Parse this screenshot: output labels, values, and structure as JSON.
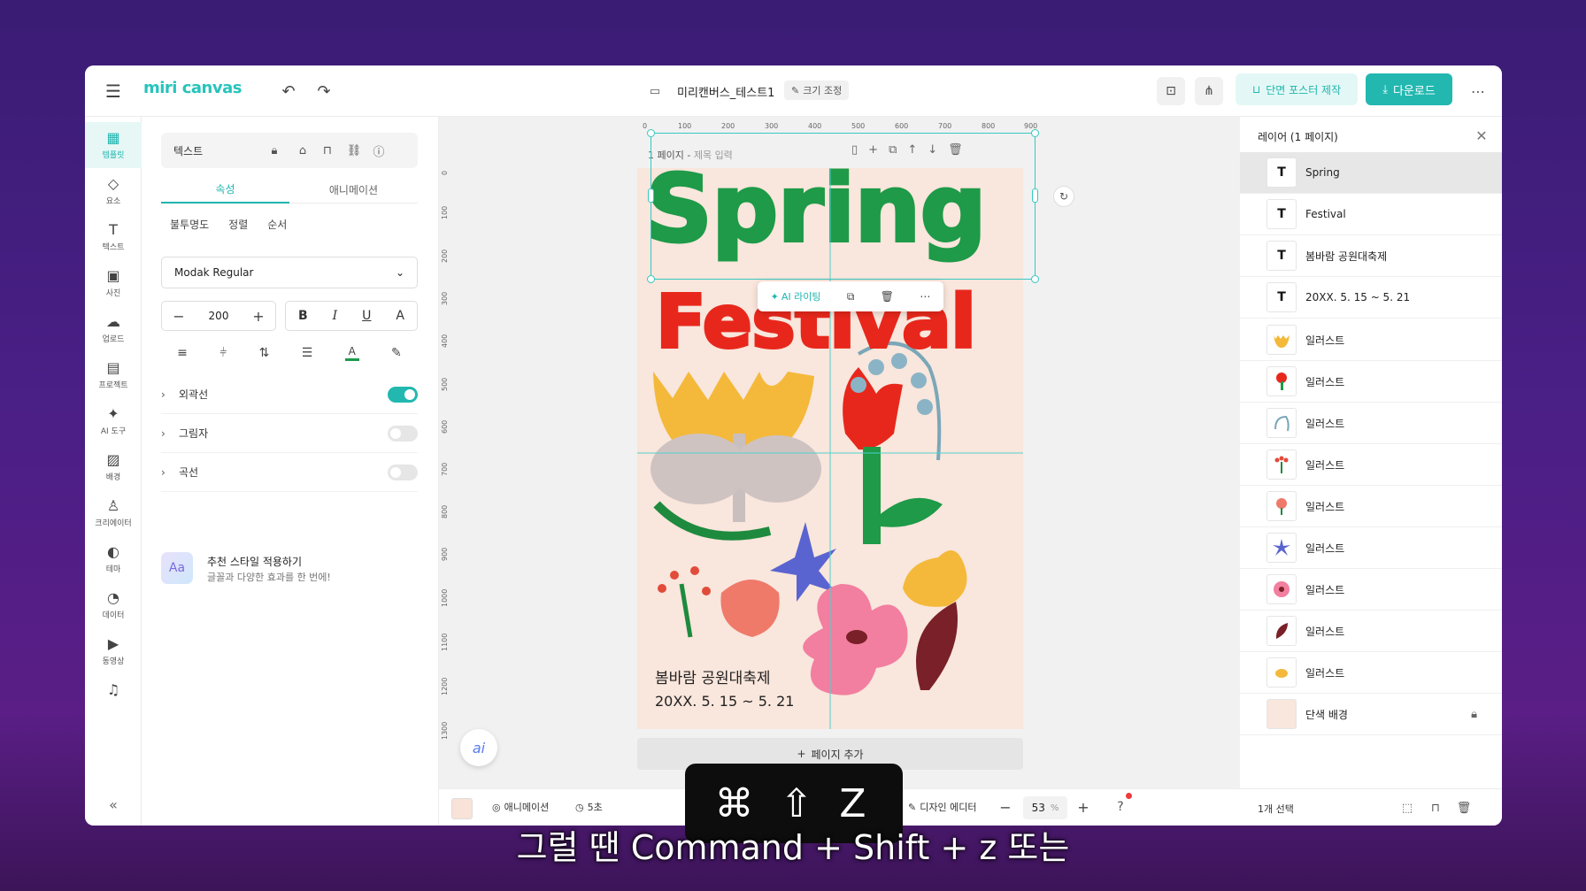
{
  "topbar": {
    "logo": "miri canvas",
    "doc_title": "미리캔버스_테스트1",
    "resize_label": "크기 조정",
    "poster_label": "단면 포스터 제작",
    "download_label": "다운로드"
  },
  "sidebar": {
    "items": [
      {
        "label": "템플릿",
        "icon": "template-icon"
      },
      {
        "label": "요소",
        "icon": "elements-icon"
      },
      {
        "label": "텍스트",
        "icon": "text-icon"
      },
      {
        "label": "사진",
        "icon": "photo-icon"
      },
      {
        "label": "업로드",
        "icon": "upload-icon"
      },
      {
        "label": "프로젝트",
        "icon": "project-icon"
      },
      {
        "label": "AI 도구",
        "icon": "ai-tool-icon"
      },
      {
        "label": "배경",
        "icon": "background-icon"
      },
      {
        "label": "크리에이터",
        "icon": "creator-icon"
      },
      {
        "label": "테마",
        "icon": "theme-icon"
      },
      {
        "label": "데이터",
        "icon": "data-icon"
      },
      {
        "label": "동영상",
        "icon": "video-icon"
      },
      {
        "label": "",
        "icon": "music-icon"
      }
    ]
  },
  "props": {
    "element_title": "텍스트",
    "tabs": [
      "속성",
      "애니메이션"
    ],
    "subtabs": [
      "불투명도",
      "정렬",
      "순서"
    ],
    "font_name": "Modak Regular",
    "font_size": "200",
    "options": [
      {
        "label": "외곽선",
        "on": true
      },
      {
        "label": "그림자",
        "on": false
      },
      {
        "label": "곡선",
        "on": false
      }
    ],
    "recommend_title": "추천 스타일 적용하기",
    "recommend_desc": "글꼴과 다양한 효과를 한 번에!",
    "recommend_icon_text": "Aa",
    "text_color": "#1b9a4c"
  },
  "canvas": {
    "ruler_top": [
      "0",
      "100",
      "200",
      "300",
      "400",
      "500",
      "600",
      "700",
      "800",
      "900"
    ],
    "ruler_left": [
      "0",
      "100",
      "200",
      "300",
      "400",
      "500",
      "600",
      "700",
      "800",
      "900",
      "1000",
      "1100",
      "1200",
      "1300"
    ],
    "page_label": "1 페이지 -",
    "page_title_placeholder": "제목 입력",
    "poster": {
      "title1": "Spring",
      "title2": "Festival",
      "line1": "봄바람 공원대축제",
      "line2": "20XX. 5. 15 ~ 5. 21",
      "bg_color": "#f9e6dc",
      "title1_color": "#1e9a48",
      "title2_color": "#e8271c"
    },
    "ai_writing_label": "AI 라이팅",
    "add_page_label": "페이지 추가",
    "ai_fab_label": "ai"
  },
  "bottom": {
    "animation_label": "애니메이션",
    "time_label": "5초",
    "design_editor_label": "디자인 에디터",
    "zoom": "53",
    "zoom_unit": "%"
  },
  "layers": {
    "title": "레이어 (1 페이지)",
    "items": [
      {
        "name": "Spring",
        "type": "text"
      },
      {
        "name": "Festival",
        "type": "text"
      },
      {
        "name": "봄바람 공원대축제",
        "type": "text"
      },
      {
        "name": "20XX. 5. 15 ~ 5. 21",
        "type": "text"
      },
      {
        "name": "일러스트",
        "type": "illust",
        "color": "#f4b93a"
      },
      {
        "name": "일러스트",
        "type": "illust",
        "color": "#e8271c"
      },
      {
        "name": "일러스트",
        "type": "illust",
        "color": "#7aa7b8"
      },
      {
        "name": "일러스트",
        "type": "illust",
        "color": "#e14b3a"
      },
      {
        "name": "일러스트",
        "type": "illust",
        "color": "#ef7a6a"
      },
      {
        "name": "일러스트",
        "type": "illust",
        "color": "#5a64d0"
      },
      {
        "name": "일러스트",
        "type": "illust",
        "color": "#f27ea0"
      },
      {
        "name": "일러스트",
        "type": "illust",
        "color": "#7a2028"
      },
      {
        "name": "일러스트",
        "type": "illust",
        "color": "#f4b93a"
      },
      {
        "name": "단색 배경",
        "type": "bg",
        "color": "#f9e6dc"
      }
    ],
    "selection_count": "1개 선택"
  },
  "overlay": {
    "shortcut": "⌘ ⇧ Z",
    "subtitle": "그럴 땐 Command + Shift + z 또는"
  }
}
